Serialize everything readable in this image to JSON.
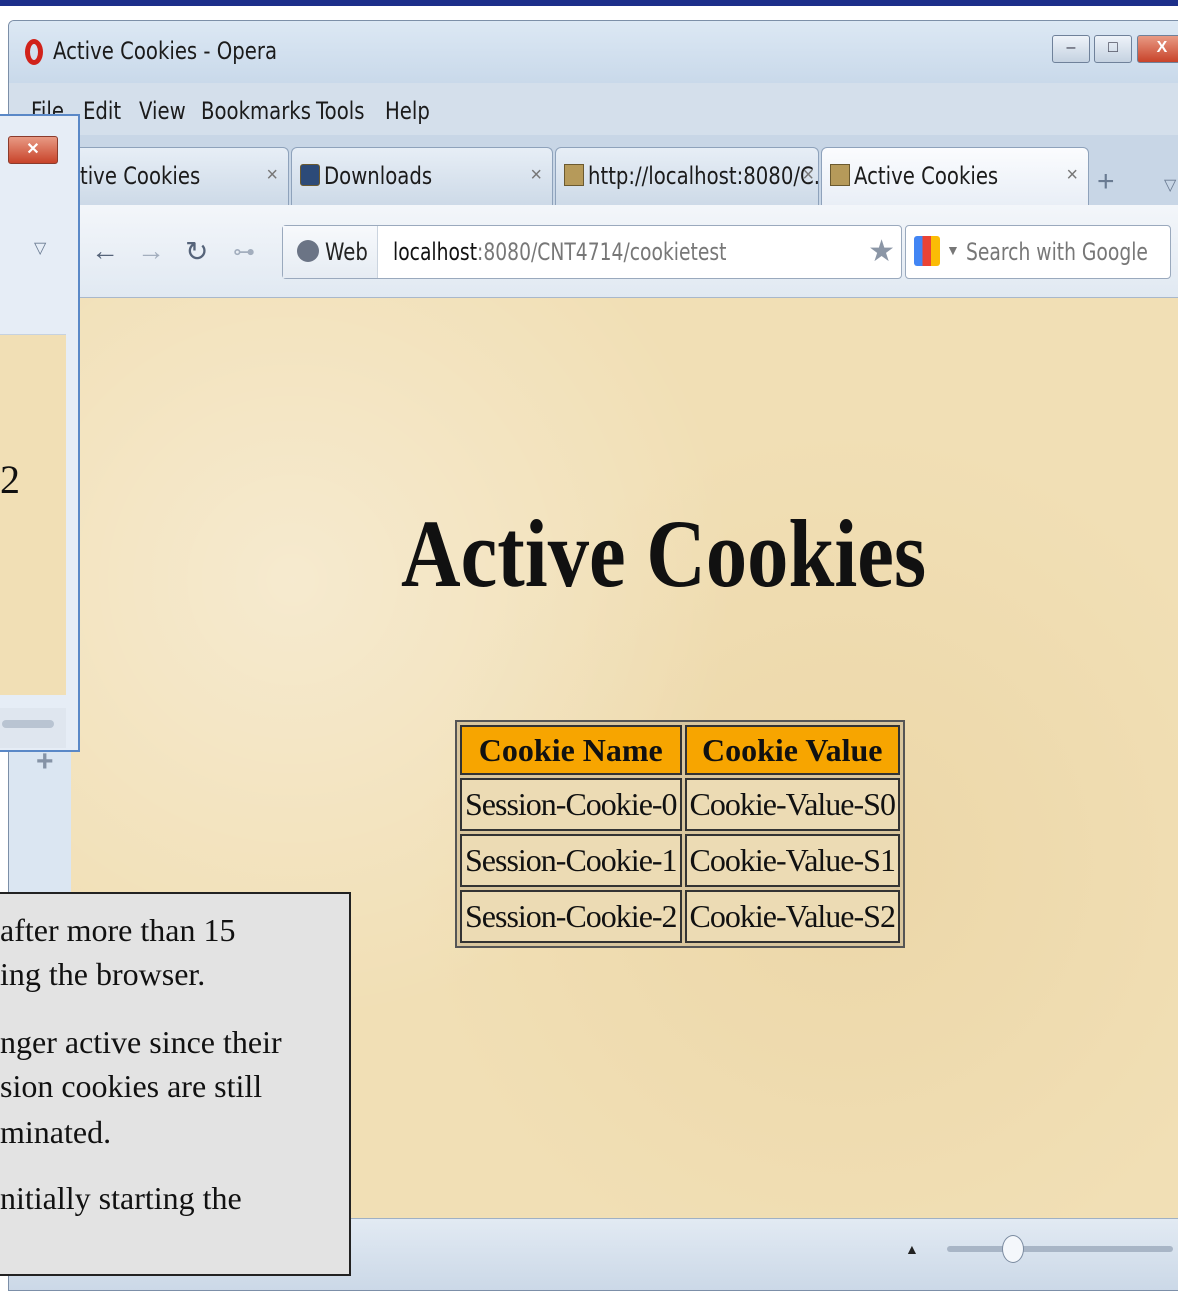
{
  "window": {
    "title": "Active Cookies - Opera",
    "controls": {
      "minimize": "–",
      "maximize": "□",
      "close": "X"
    }
  },
  "menu": [
    "File",
    "Edit",
    "View",
    "Bookmarks",
    "Tools",
    "Help"
  ],
  "tabs": [
    {
      "label": "tive Cookies",
      "close": "×"
    },
    {
      "label": "Downloads",
      "close": "×"
    },
    {
      "label": "http://localhost:8080/C...",
      "close": "×"
    },
    {
      "label": "Active Cookies",
      "close": "×"
    }
  ],
  "toolbar": {
    "web_label": "Web",
    "url_host": "localhost",
    "url_path": ":8080/CNT4714/cookietest",
    "search_placeholder": "Search with Google"
  },
  "page": {
    "heading": "Active Cookies",
    "table": {
      "headers": [
        "Cookie Name",
        "Cookie Value"
      ],
      "rows": [
        [
          "Session-Cookie-0",
          "Cookie-Value-S0"
        ],
        [
          "Session-Cookie-1",
          "Cookie-Value-S1"
        ],
        [
          "Session-Cookie-2",
          "Cookie-Value-S2"
        ]
      ]
    }
  },
  "back_window": {
    "partial_text": "2"
  },
  "note": {
    "lines": [
      "after more than 15",
      "ing the browser.",
      "nger active since their",
      "sion cookies are still",
      "minated.",
      "nitially starting the"
    ]
  },
  "colors": {
    "header_orange": "#f7a500",
    "page_background": "#f1dfb5",
    "window_chrome": "#dbe6f2"
  }
}
